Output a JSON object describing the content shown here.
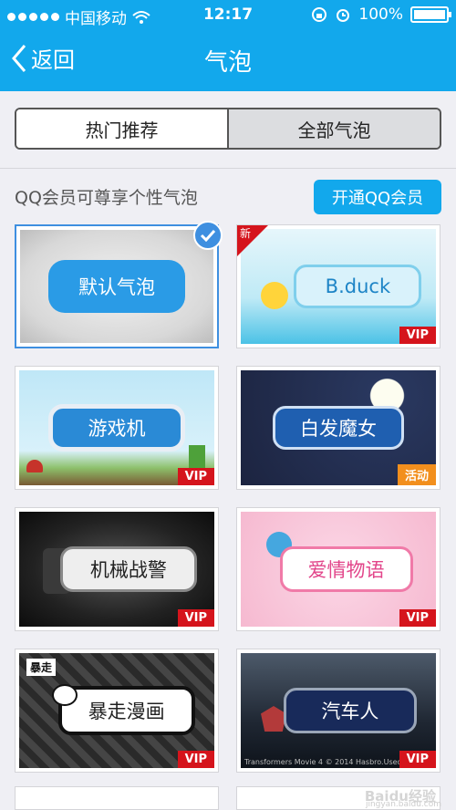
{
  "status_bar": {
    "carrier": "中国移动",
    "time": "12:17",
    "battery": "100%",
    "battery_level": 1.0
  },
  "nav": {
    "back_label": "返回",
    "title": "气泡"
  },
  "segments": [
    {
      "label": "热门推荐",
      "active": true
    },
    {
      "label": "全部气泡",
      "active": false
    }
  ],
  "promo": {
    "text": "QQ会员可尊享个性气泡",
    "button_label": "开通QQ会员"
  },
  "bubbles": [
    {
      "label": "默认气泡",
      "selected": true,
      "badge": ""
    },
    {
      "label": "B.duck",
      "badge": "VIP",
      "corner": "新"
    },
    {
      "label": "游戏机",
      "badge": "VIP"
    },
    {
      "label": "白发魔女",
      "badge": "活动"
    },
    {
      "label": "机械战警",
      "badge": "VIP"
    },
    {
      "label": "爱情物语",
      "badge": "VIP"
    },
    {
      "label": "暴走漫画",
      "badge": "VIP",
      "sticker": "暴走"
    },
    {
      "label": "汽车人",
      "badge": "VIP",
      "caption": "Transformers Movie 4 © 2014 Hasbro.Used with per"
    }
  ],
  "watermark": {
    "brand": "Baidu经验",
    "url": "jingyan.baidu.com"
  },
  "colors": {
    "accent": "#12a8ec",
    "vip": "#d5141c",
    "activity": "#f28f1d",
    "selected": "#3e8fe0"
  }
}
